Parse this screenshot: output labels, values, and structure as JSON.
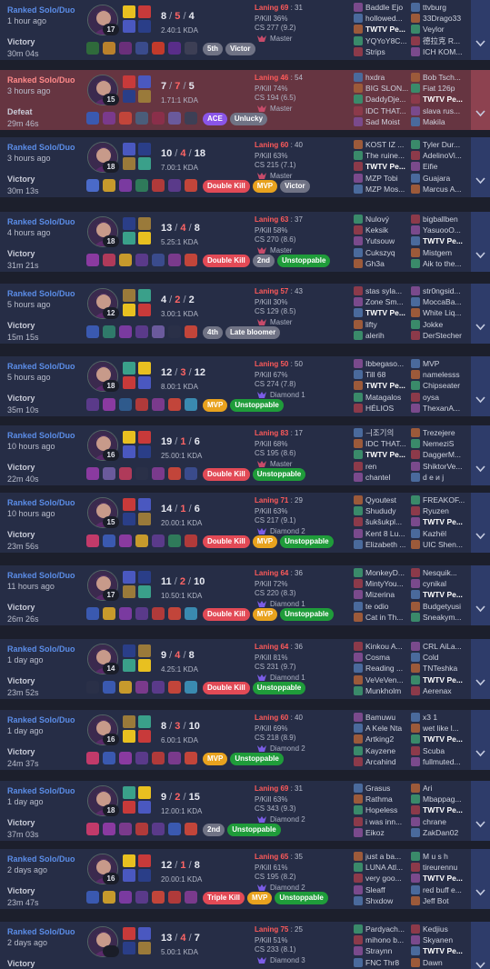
{
  "colors": {
    "row_bg": "#262d46",
    "defeat_bg": "#663541",
    "queue_blue": "#5b8de8",
    "death_red": "#ff6565",
    "badge_red": "#e24a56",
    "badge_gold": "#e8a21e",
    "badge_green": "#1f9c3a",
    "badge_gray": "#707385",
    "badge_purple": "#8a55e8",
    "rank_master": "#c74b6a",
    "rank_diamond": "#7b5ce6"
  },
  "matches": [
    {
      "queue": "Ranked Solo/Duo",
      "time_ago": "1 hour ago",
      "result": "Victory",
      "duration": "30m 04s",
      "level": "17",
      "kills": "8",
      "deaths": "5",
      "assists": "4",
      "ratio": "2.40:1 KDA",
      "laning_label": "Laning 69",
      "laning_score": "31",
      "pkill": "P/Kill 36%",
      "cs": "CS 277 (9.2)",
      "rank": "Master",
      "rank_icon": "master-crest-icon",
      "items": [
        "#2f6a3b",
        "#b9812c",
        "#6a2f7a",
        "#3a4b8c",
        "#c23a2b",
        "#592d8a",
        "#3d3f55"
      ],
      "badges": [
        {
          "t": "5th",
          "c": "gray"
        },
        {
          "t": "Victor",
          "c": "gray"
        }
      ],
      "team1": [
        "Baddle Ejo",
        "hollowed...",
        "TWTV Pe...",
        "YQYoY8C...",
        "Strips"
      ],
      "team2": [
        "ttvburg",
        "33Drago33",
        "Veylor",
        "德拉克 R...",
        "ICH KOM..."
      ],
      "me": [
        0,
        2
      ]
    },
    {
      "queue": "Ranked Solo/Duo",
      "time_ago": "3 hours ago",
      "result": "Defeat",
      "duration": "29m 46s",
      "level": "15",
      "kills": "7",
      "deaths": "7",
      "assists": "5",
      "ratio": "1.71:1 KDA",
      "laning_label": "Laning 46",
      "laning_score": "54",
      "pkill": "P/Kill 74%",
      "cs": "CS 194 (6.5)",
      "rank": "Master",
      "rank_icon": "master-crest-icon",
      "items": [
        "#3a59b0",
        "#7a3a8c",
        "#c2453a",
        "#4a5d7a",
        "#8a2f4a",
        "#6a5a9c",
        "#3d3f55"
      ],
      "badges": [
        {
          "t": "ACE",
          "c": "purple"
        },
        {
          "t": "Unlucky",
          "c": "gray"
        }
      ],
      "team1": [
        "hxdra",
        "BIG SLON...",
        "DaddyDje...",
        "IDC THAT...",
        "Sad Moist"
      ],
      "team2": [
        "Bob Tsch...",
        "Fiat 126p",
        "TWTV Pe...",
        "slava rus...",
        "Makila"
      ],
      "me": [
        1,
        2
      ]
    },
    {
      "queue": "Ranked Solo/Duo",
      "time_ago": "3 hours ago",
      "result": "Victory",
      "duration": "30m 13s",
      "level": "18",
      "kills": "10",
      "deaths": "4",
      "assists": "18",
      "ratio": "7.00:1 KDA",
      "laning_label": "Laning 60",
      "laning_score": "40",
      "pkill": "P/Kill 63%",
      "cs": "CS 215 (7.1)",
      "rank": "Master",
      "rank_icon": "master-crest-icon",
      "items": [
        "#4a6ac8",
        "#c79a2c",
        "#7a3aa0",
        "#2f7a5a",
        "#b03a3a",
        "#5a3a8a",
        "#c2453a"
      ],
      "badges": [
        {
          "t": "Double Kill",
          "c": "red"
        },
        {
          "t": "MVP",
          "c": "gold"
        },
        {
          "t": "Victor",
          "c": "gray"
        }
      ],
      "team1": [
        "KOST IZ ...",
        "The ruine...",
        "TWTV Pe...",
        "MZP Tobi",
        "MZP Mos..."
      ],
      "team2": [
        "Tyler Dur...",
        "AdelinoVi...",
        "Eifie",
        "Guajara",
        "Marcus A..."
      ],
      "me": [
        0,
        2
      ]
    },
    {
      "queue": "Ranked Solo/Duo",
      "time_ago": "4 hours ago",
      "result": "Victory",
      "duration": "31m 21s",
      "level": "18",
      "kills": "13",
      "deaths": "4",
      "assists": "8",
      "ratio": "5.25:1 KDA",
      "laning_label": "Laning 63",
      "laning_score": "37",
      "pkill": "P/Kill 58%",
      "cs": "CS 270 (8.6)",
      "rank": "Master",
      "rank_icon": "master-crest-icon",
      "items": [
        "#8a3aa0",
        "#b03a5a",
        "#c79a2c",
        "#5a3a8a",
        "#3a4b8c",
        "#7a3a8c",
        "#c2453a"
      ],
      "badges": [
        {
          "t": "Double Kill",
          "c": "red"
        },
        {
          "t": "2nd",
          "c": "gray"
        },
        {
          "t": "Unstoppable",
          "c": "green"
        }
      ],
      "team1": [
        "Nulový",
        "Keksik",
        "Yutsouw",
        "Cukszyq",
        "Gh3a"
      ],
      "team2": [
        "bigballben",
        "YasuooO...",
        "TWTV Pe...",
        "Mistgem",
        "Aik to the..."
      ],
      "me": [
        1,
        2
      ]
    },
    {
      "queue": "Ranked Solo/Duo",
      "time_ago": "5 hours ago",
      "result": "Victory",
      "duration": "15m 15s",
      "level": "12",
      "kills": "4",
      "deaths": "2",
      "assists": "2",
      "ratio": "3.00:1 KDA",
      "laning_label": "Laning 57",
      "laning_score": "43",
      "pkill": "P/Kill 30%",
      "cs": "CS 129 (8.5)",
      "rank": "Master",
      "rank_icon": "master-crest-icon",
      "items": [
        "#3a59b0",
        "#2f7a6a",
        "#7a3aa0",
        "#5a3a8a",
        "#6a5a9c",
        "#2a3048",
        "#c2453a"
      ],
      "badges": [
        {
          "t": "4th",
          "c": "gray"
        },
        {
          "t": "Late bloomer",
          "c": "gray"
        }
      ],
      "team1": [
        "stas syla...",
        "Zone Sm...",
        "TWTV Pe...",
        "lifty",
        "alerih"
      ],
      "team2": [
        "str0ngsid...",
        "MoccaBa...",
        "White Liq...",
        "Jokke",
        "DerStecher"
      ],
      "me": [
        0,
        2
      ]
    },
    {
      "queue": "Ranked Solo/Duo",
      "time_ago": "5 hours ago",
      "result": "Victory",
      "duration": "35m 10s",
      "level": "18",
      "kills": "12",
      "deaths": "3",
      "assists": "12",
      "ratio": "8.00:1 KDA",
      "laning_label": "Laning 50",
      "laning_score": "50",
      "pkill": "P/Kill 67%",
      "cs": "CS 274 (7.8)",
      "rank": "Diamond 1",
      "rank_icon": "diamond-crest-icon",
      "items": [
        "#5a3a8a",
        "#8a3aa0",
        "#2f5a8c",
        "#b03a3a",
        "#7a3a8c",
        "#c2453a",
        "#3a8ab0"
      ],
      "badges": [
        {
          "t": "MVP",
          "c": "gold"
        },
        {
          "t": "Unstoppable",
          "c": "green"
        }
      ],
      "team1": [
        "Ibbegaso...",
        "Till 68",
        "TWTV Pe...",
        "Matagalos",
        "HÉLIOS"
      ],
      "team2": [
        "MVP",
        "namelesss",
        "Chipseater",
        "oysa",
        "ThexanA..."
      ],
      "me": [
        0,
        2
      ]
    },
    {
      "queue": "Ranked Solo/Duo",
      "time_ago": "10 hours ago",
      "result": "Victory",
      "duration": "22m 40s",
      "level": "16",
      "kills": "19",
      "deaths": "1",
      "assists": "6",
      "ratio": "25.00:1 KDA",
      "laning_label": "Laning 83",
      "laning_score": "17",
      "pkill": "P/Kill 68%",
      "cs": "CS 195 (8.6)",
      "rank": "Master",
      "rank_icon": "master-crest-icon",
      "items": [
        "#8a3aa0",
        "#6a5a9c",
        "#b03a5a",
        "#2a3048",
        "#7a3a8c",
        "#c2453a",
        "#3a4b8c"
      ],
      "badges": [
        {
          "t": "Double Kill",
          "c": "red"
        },
        {
          "t": "Unstoppable",
          "c": "green"
        }
      ],
      "team1": [
        "ㅢ조기의",
        "IDC THAT...",
        "TWTV Pe...",
        "ren",
        "chantel"
      ],
      "team2": [
        "Trezejere",
        "NemeziS",
        "DaggerM...",
        "ShiktorVe...",
        "ԁ е и j"
      ],
      "me": [
        0,
        2
      ]
    },
    {
      "queue": "Ranked Solo/Duo",
      "time_ago": "10 hours ago",
      "result": "Victory",
      "duration": "23m 56s",
      "level": "15",
      "kills": "14",
      "deaths": "1",
      "assists": "6",
      "ratio": "20.00:1 KDA",
      "laning_label": "Laning 71",
      "laning_score": "29",
      "pkill": "P/Kill 63%",
      "cs": "CS 217 (9.1)",
      "rank": "Diamond 2",
      "rank_icon": "diamond-crest-icon",
      "items": [
        "#c23a6a",
        "#3a59b0",
        "#8a3aa0",
        "#c79a2c",
        "#5a3a8a",
        "#2f7a5a",
        "#b03a3a"
      ],
      "badges": [
        {
          "t": "Double Kill",
          "c": "red"
        },
        {
          "t": "MVP",
          "c": "gold"
        },
        {
          "t": "Unstoppable",
          "c": "green"
        }
      ],
      "team1": [
        "Qyoutest",
        "Shududy",
        "šukšukpl...",
        "Kent 8 Lu...",
        "Elizabeth ..."
      ],
      "team2": [
        "FREAKOF...",
        "Ryuzen",
        "TWTV Pe...",
        "Kazhël",
        "UIC Shen..."
      ],
      "me": [
        1,
        2
      ]
    },
    {
      "queue": "Ranked Solo/Duo",
      "time_ago": "11 hours ago",
      "result": "Victory",
      "duration": "26m 26s",
      "level": "17",
      "kills": "11",
      "deaths": "2",
      "assists": "10",
      "ratio": "10.50:1 KDA",
      "laning_label": "Laning 64",
      "laning_score": "36",
      "pkill": "P/Kill 72%",
      "cs": "CS 220 (8.3)",
      "rank": "Diamond 1",
      "rank_icon": "diamond-crest-icon",
      "items": [
        "#3a59b0",
        "#c79a2c",
        "#7a3aa0",
        "#5a3a8a",
        "#b03a3a",
        "#c2453a",
        "#3a8ab0"
      ],
      "badges": [
        {
          "t": "Double Kill",
          "c": "red"
        },
        {
          "t": "MVP",
          "c": "gold"
        },
        {
          "t": "Unstoppable",
          "c": "green"
        }
      ],
      "team1": [
        "MonkeyD...",
        "MintyYou...",
        "Mizerina",
        "te odio",
        "Cat in Th..."
      ],
      "team2": [
        "Nesquik...",
        "cynikal",
        "TWTV Pe...",
        "Budgetyusi",
        "Sneakym..."
      ],
      "me": [
        1,
        2
      ]
    },
    {
      "queue": "Ranked Solo/Duo",
      "time_ago": "1 day ago",
      "result": "Victory",
      "duration": "23m 52s",
      "level": "14",
      "kills": "9",
      "deaths": "4",
      "assists": "8",
      "ratio": "4.25:1 KDA",
      "laning_label": "Laning 64",
      "laning_score": "36",
      "pkill": "P/Kill 81%",
      "cs": "CS 231 (9.7)",
      "rank": "Diamond 1",
      "rank_icon": "diamond-crest-icon",
      "items": [
        "#2a3048",
        "#3a59b0",
        "#c79a2c",
        "#7a3a8c",
        "#5a3a8a",
        "#c2453a",
        "#3a8ab0"
      ],
      "badges": [
        {
          "t": "Double Kill",
          "c": "red"
        },
        {
          "t": "Unstoppable",
          "c": "green"
        }
      ],
      "team1": [
        "Kinkou A...",
        "Cosma",
        "Reading ...",
        "VeVeVen...",
        "Munkholm"
      ],
      "team2": [
        "CRL AiLa...",
        "Cold",
        "TNTeshka",
        "TWTV Pe...",
        "Aerenax"
      ],
      "me": [
        1,
        3
      ]
    },
    {
      "queue": "Ranked Solo/Duo",
      "time_ago": "1 day ago",
      "result": "Victory",
      "duration": "24m 37s",
      "level": "16",
      "kills": "8",
      "deaths": "3",
      "assists": "10",
      "ratio": "6.00:1 KDA",
      "laning_label": "Laning 60",
      "laning_score": "40",
      "pkill": "P/Kill 69%",
      "cs": "CS 218 (8.9)",
      "rank": "Diamond 2",
      "rank_icon": "diamond-crest-icon",
      "items": [
        "#c23a6a",
        "#3a59b0",
        "#8a3aa0",
        "#5a3a8a",
        "#b03a3a",
        "#7a3a8c",
        "#c2453a"
      ],
      "badges": [
        {
          "t": "MVP",
          "c": "gold"
        },
        {
          "t": "Unstoppable",
          "c": "green"
        }
      ],
      "team1": [
        "Bamuwu",
        "A Kele Nta",
        "Artking2",
        "Kayzene",
        "Arcahind"
      ],
      "team2": [
        "x3 1",
        "wet like l...",
        "TWTV Pe...",
        "Scuba",
        "fullmuted..."
      ],
      "me": [
        1,
        2
      ]
    },
    {
      "queue": "Ranked Solo/Duo",
      "time_ago": "1 day ago",
      "result": "Victory",
      "duration": "37m 03s",
      "level": "18",
      "kills": "9",
      "deaths": "2",
      "assists": "15",
      "ratio": "12.00:1 KDA",
      "laning_label": "Laning 69",
      "laning_score": "31",
      "pkill": "P/Kill 63%",
      "cs": "CS 343 (9.3)",
      "rank": "Diamond 2",
      "rank_icon": "diamond-crest-icon",
      "items": [
        "#c23a6a",
        "#8a3aa0",
        "#7a3a8c",
        "#b03a3a",
        "#5a3a8a",
        "#3a59b0",
        "#c2453a"
      ],
      "badges": [
        {
          "t": "2nd",
          "c": "gray"
        },
        {
          "t": "Unstoppable",
          "c": "green"
        }
      ],
      "team1": [
        "Grasus",
        "Rathma",
        "Hopeless",
        "i was inn...",
        "Eikoz"
      ],
      "team2": [
        "Ari",
        "Mbappag...",
        "TWTV Pe...",
        "chrane",
        "ZakDan02"
      ],
      "me": [
        1,
        2
      ]
    },
    {
      "queue": "Ranked Solo/Duo",
      "time_ago": "2 days ago",
      "result": "Victory",
      "duration": "23m 47s",
      "level": "16",
      "kills": "12",
      "deaths": "1",
      "assists": "8",
      "ratio": "20.00:1 KDA",
      "laning_label": "Laning 65",
      "laning_score": "35",
      "pkill": "P/Kill 61%",
      "cs": "CS 195 (8.2)",
      "rank": "Diamond 2",
      "rank_icon": "diamond-crest-icon",
      "items": [
        "#3a59b0",
        "#c79a2c",
        "#7a3aa0",
        "#5a3a8a",
        "#c2453a",
        "#b03a3a",
        "#7a3a8c"
      ],
      "badges": [
        {
          "t": "Triple Kill",
          "c": "red"
        },
        {
          "t": "MVP",
          "c": "gold"
        },
        {
          "t": "Unstoppable",
          "c": "green"
        }
      ],
      "team1": [
        "just a ba...",
        "LUNA Atl...",
        "very goo...",
        "Sleaff",
        "Shxdow"
      ],
      "team2": [
        "M u s h",
        "tireurennu",
        "TWTV Pe...",
        "red buff e...",
        "Jeff Bot"
      ],
      "me": [
        1,
        2
      ]
    },
    {
      "queue": "Ranked Solo/Duo",
      "time_ago": "2 days ago",
      "result": "Victory",
      "duration": "",
      "level": "",
      "kills": "13",
      "deaths": "4",
      "assists": "7",
      "ratio": "5.00:1 KDA",
      "laning_label": "Laning 75",
      "laning_score": "25",
      "pkill": "P/Kill 51%",
      "cs": "CS 233 (8.1)",
      "rank": "Diamond 3",
      "rank_icon": "diamond-crest-icon",
      "items": [],
      "badges": [],
      "team1": [
        "Pardyach...",
        "mihono b...",
        "Straynn",
        "FNC Thr8"
      ],
      "team2": [
        "Kedjius",
        "Skyanen",
        "TWTV Pe...",
        "Dawn"
      ],
      "me": [
        1,
        2
      ]
    }
  ]
}
